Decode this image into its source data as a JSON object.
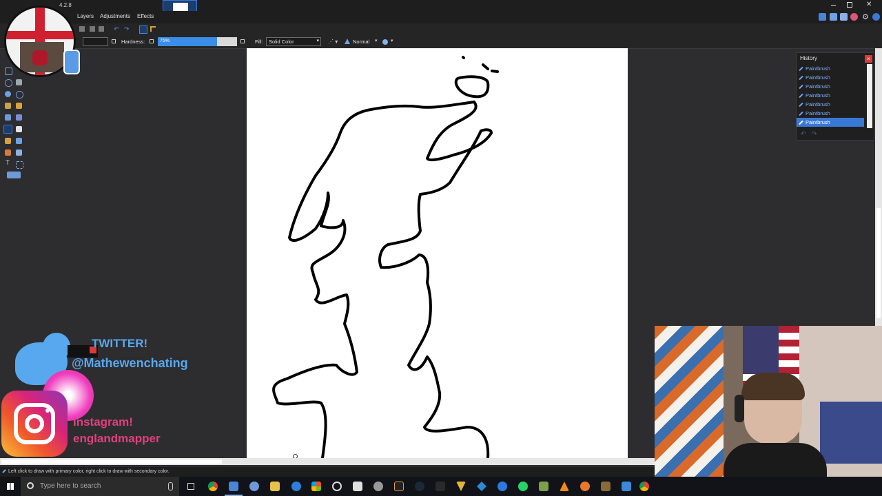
{
  "app": {
    "version": "4.2.8"
  },
  "menu": {
    "items": [
      "Layers",
      "Adjustments",
      "Effects"
    ]
  },
  "toolbar": {
    "hardness_label": "Hardness:",
    "hardness_value": "75%",
    "hardness_fraction": 0.75,
    "fill_label": "Fill:",
    "fill_value": "Solid Color",
    "blend_mode": "Normal"
  },
  "history": {
    "title": "History",
    "items": [
      "Paintbrush",
      "Paintbrush",
      "Paintbrush",
      "Paintbrush",
      "Paintbrush",
      "Paintbrush",
      "Paintbrush"
    ],
    "selected_index": 6
  },
  "status": {
    "hint": "Left click to draw with primary color, right click to draw with secondary color."
  },
  "taskbar": {
    "search_placeholder": "Type here to search"
  },
  "overlay": {
    "twitter_heading": "TWITTER!",
    "twitter_handle": "@Mathewenchating",
    "instagram_heading": "Instagram!",
    "instagram_handle": "englandmapper"
  },
  "colors": {
    "accent": "#3a78d8",
    "twitter": "#58a8ef",
    "instagram_text": "#e0407c",
    "close_red": "#d83b3b"
  }
}
